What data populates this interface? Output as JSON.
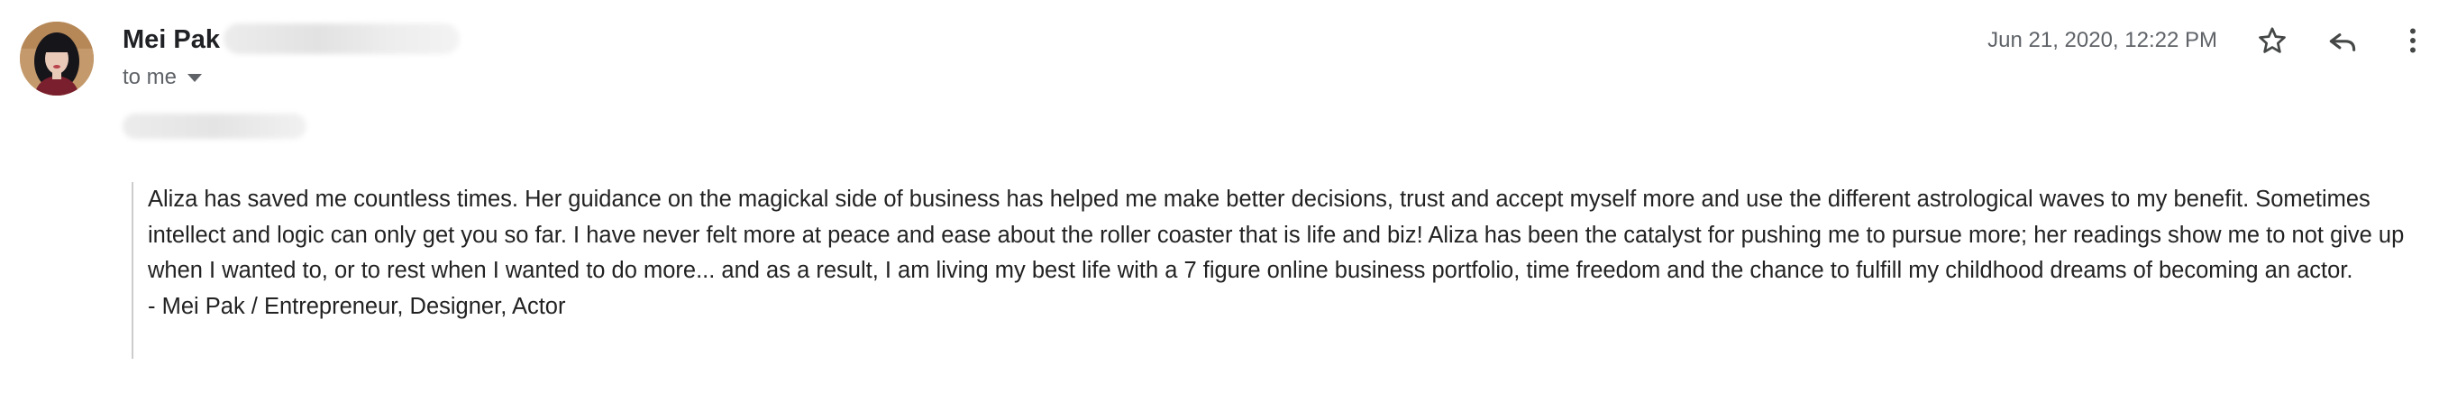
{
  "sender": {
    "name": "Mei Pak",
    "to_label": "to me"
  },
  "header": {
    "date": "Jun 21, 2020, 12:22 PM"
  },
  "icons": {
    "star": "star-icon",
    "reply": "reply-icon",
    "more": "more-vert-icon",
    "dropdown": "caret-down-icon"
  },
  "colors": {
    "text_primary": "#202124",
    "text_secondary": "#5f6368",
    "quote_border": "#cccccc"
  },
  "message": {
    "quote_body": "Aliza has saved me countless times. Her guidance on the magickal side of business has helped me make better decisions, trust and accept myself more and use the different astrological waves to my benefit. Sometimes intellect and logic can only get you so far. I have never felt more at peace and ease about the roller coaster that is life and biz! Aliza has been the catalyst for pushing me to pursue more; her readings show me to not give up when I wanted to, or to rest when I wanted to do more... and as a result, I am living my best life with a 7 figure online business portfolio, time freedom and the chance to fulfill my childhood dreams of becoming an actor.",
    "signature": "- Mei Pak / Entrepreneur, Designer, Actor"
  }
}
